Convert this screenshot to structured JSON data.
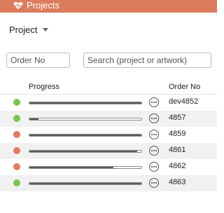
{
  "header": {
    "title": "Projects",
    "icon": "heart-pulse-icon",
    "background_color": "#dc7c5c"
  },
  "filter": {
    "selected": "Project"
  },
  "search": {
    "order_placeholder": "Order No",
    "search_placeholder": "Search (project or artwork)"
  },
  "table": {
    "columns": {
      "progress": "Progress",
      "order_no": "Order No"
    },
    "status_colors": {
      "green": "#7bc44e",
      "red": "#e07b5e"
    },
    "rows": [
      {
        "status": "green",
        "progress": 1.0,
        "order_no": "dev4852"
      },
      {
        "status": "green",
        "progress": 0.08,
        "order_no": "4857"
      },
      {
        "status": "red",
        "progress": 1.0,
        "order_no": "4859"
      },
      {
        "status": "red",
        "progress": 0.96,
        "order_no": "4861"
      },
      {
        "status": "red",
        "progress": 0.75,
        "order_no": "4862"
      },
      {
        "status": "green",
        "progress": 1.0,
        "order_no": "4863"
      }
    ]
  }
}
